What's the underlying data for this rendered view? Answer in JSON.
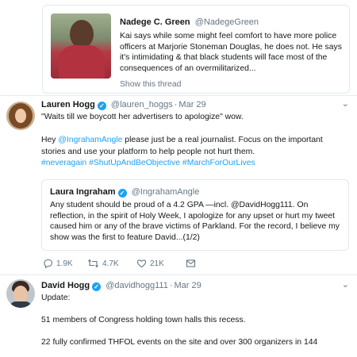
{
  "quoted_thread": {
    "name": "Nadege C. Green",
    "handle": "@NadegeGreen",
    "text": "Kai says while some might feel comfort to have more police officers at Marjorie Stoneman Douglas, he does not. He says it's intimidating & that black students will face most of the consequences of an overmilitarized...",
    "show_thread": "Show this thread"
  },
  "tweet1": {
    "name": "Lauren Hogg",
    "handle": "@lauren_hoggs",
    "date": "Mar 29",
    "line1": "\"Waits till we boycott her advertisers to apologize\" wow.",
    "mention": "@IngrahamAngle",
    "hey": "Hey ",
    "rest": " please just be a real journalist. Focus on the important stories and use your platform to help people not hurt them.",
    "hashtags": "#neveragain #ShutUpAndBeObjective #MarchForOurLives",
    "quote": {
      "name": "Laura Ingraham",
      "handle": "@IngrahamAngle",
      "text": "Any student should be proud of a 4.2 GPA —incl. @DavidHogg111.  On reflection, in the spirit of Holy Week, I apologize for any upset or hurt my tweet caused him or any of the brave victims of Parkland. For the record, I believe my show was the first to feature David...(1/2)"
    },
    "actions": {
      "replies": "1.9K",
      "retweets": "4.7K",
      "likes": "21K"
    }
  },
  "tweet2": {
    "name": "David Hogg",
    "handle": "@davidhogg111",
    "date": "Mar 29",
    "line1": "Update:",
    "line2": "51 members of Congress holding town halls this recess.",
    "line3": "22 fully confirmed THFOL events on the site and over 300 organizers in 144"
  },
  "colors": {
    "accent": "#1da1f2",
    "muted": "#657786",
    "border": "#e1e8ed"
  },
  "icons": [
    "verified-badge-icon",
    "chevron-down-icon",
    "reply-icon",
    "retweet-icon",
    "heart-icon",
    "direct-message-icon"
  ]
}
